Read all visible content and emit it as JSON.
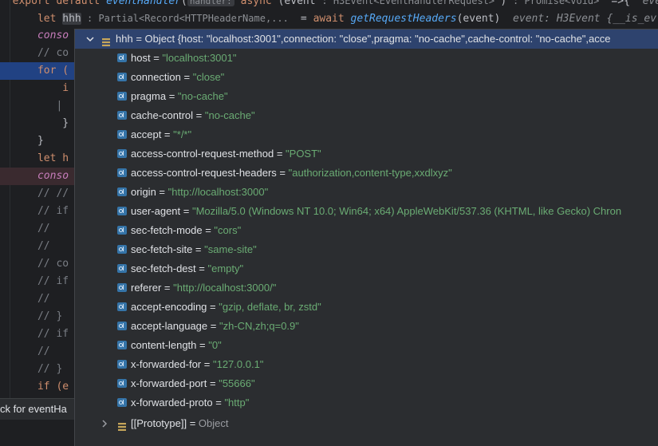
{
  "editor": {
    "lines": [
      {
        "parts": [
          {
            "t": "export default ",
            "c": "kw"
          },
          {
            "t": "eventHandler",
            "c": "fn-italic"
          },
          {
            "t": "(",
            "c": "var"
          },
          {
            "t": "handler:",
            "c": "hint-box"
          },
          {
            "t": " async ",
            "c": "kw"
          },
          {
            "t": "(event ",
            "c": "var"
          },
          {
            "t": ": H3Event<EventHandlerRequest> ",
            "c": "hint"
          },
          {
            "t": ") ",
            "c": "var"
          },
          {
            "t": ": Promise<void> ",
            "c": "hint"
          },
          {
            "t": " =>{  ",
            "c": "var"
          },
          {
            "t": "event",
            "c": "inline-val"
          }
        ]
      },
      {
        "parts": [
          {
            "t": "    let ",
            "c": "kw"
          },
          {
            "t": "hhh",
            "c": "ident-box"
          },
          {
            "t": " : Partial<Record<HTTPHeaderName,... ",
            "c": "hint"
          },
          {
            "t": " = ",
            "c": "var"
          },
          {
            "t": "await ",
            "c": "kw"
          },
          {
            "t": "getRequestHeaders",
            "c": "fn-italic"
          },
          {
            "t": "(event)  ",
            "c": "var"
          },
          {
            "t": "event: H3Event {__is_ev",
            "c": "inline-val"
          }
        ]
      },
      {
        "parts": [
          {
            "t": "    conso",
            "c": "purple"
          }
        ]
      },
      {
        "parts": [
          {
            "t": "    // co",
            "c": "cmt"
          }
        ]
      },
      {
        "parts": [
          {
            "t": "    for (",
            "c": "kw"
          }
        ],
        "style": "hl-line"
      },
      {
        "parts": [
          {
            "t": "        i",
            "c": "kw"
          }
        ]
      },
      {
        "parts": [
          {
            "t": "       |",
            "c": "cmt"
          }
        ]
      },
      {
        "parts": [
          {
            "t": "        }",
            "c": "var"
          }
        ]
      },
      {
        "parts": [
          {
            "t": "    }",
            "c": "var"
          }
        ]
      },
      {
        "parts": [
          {
            "t": "    let h",
            "c": "kw"
          }
        ]
      },
      {
        "parts": [
          {
            "t": "    conso",
            "c": "purple"
          }
        ],
        "style": "err-line"
      },
      {
        "parts": [
          {
            "t": "    // //",
            "c": "cmt"
          }
        ]
      },
      {
        "parts": [
          {
            "t": "    // if",
            "c": "cmt"
          }
        ]
      },
      {
        "parts": [
          {
            "t": "    //",
            "c": "cmt"
          }
        ]
      },
      {
        "parts": [
          {
            "t": "    //",
            "c": "cmt"
          }
        ]
      },
      {
        "parts": [
          {
            "t": "    // co",
            "c": "cmt"
          }
        ]
      },
      {
        "parts": [
          {
            "t": "    // if",
            "c": "cmt"
          }
        ]
      },
      {
        "parts": [
          {
            "t": "    //",
            "c": "cmt"
          }
        ]
      },
      {
        "parts": [
          {
            "t": "    // }",
            "c": "cmt"
          }
        ]
      },
      {
        "parts": [
          {
            "t": "    // if",
            "c": "cmt"
          }
        ]
      },
      {
        "parts": [
          {
            "t": "    //",
            "c": "cmt"
          }
        ]
      },
      {
        "parts": [
          {
            "t": "    // }",
            "c": "cmt"
          }
        ]
      },
      {
        "parts": [
          {
            "t": "    if (e",
            "c": "kw"
          }
        ]
      }
    ],
    "status_tip": "ck for eventHa"
  },
  "popup": {
    "root": {
      "name": "hhh",
      "summary": "Object {host: \"localhost:3001\",connection: \"close\",pragma: \"no-cache\",cache-control: \"no-cache\",acce"
    },
    "fields": [
      {
        "name": "host",
        "value": "\"localhost:3001\""
      },
      {
        "name": "connection",
        "value": "\"close\""
      },
      {
        "name": "pragma",
        "value": "\"no-cache\""
      },
      {
        "name": "cache-control",
        "value": "\"no-cache\""
      },
      {
        "name": "accept",
        "value": "\"*/*\""
      },
      {
        "name": "access-control-request-method",
        "value": "\"POST\""
      },
      {
        "name": "access-control-request-headers",
        "value": "\"authorization,content-type,xxdlxyz\""
      },
      {
        "name": "origin",
        "value": "\"http://localhost:3000\""
      },
      {
        "name": "user-agent",
        "value": "\"Mozilla/5.0 (Windows NT 10.0; Win64; x64) AppleWebKit/537.36 (KHTML, like Gecko) Chron"
      },
      {
        "name": "sec-fetch-mode",
        "value": "\"cors\""
      },
      {
        "name": "sec-fetch-site",
        "value": "\"same-site\""
      },
      {
        "name": "sec-fetch-dest",
        "value": "\"empty\""
      },
      {
        "name": "referer",
        "value": "\"http://localhost:3000/\""
      },
      {
        "name": "accept-encoding",
        "value": "\"gzip, deflate, br, zstd\""
      },
      {
        "name": "accept-language",
        "value": "\"zh-CN,zh;q=0.9\""
      },
      {
        "name": "content-length",
        "value": "\"0\""
      },
      {
        "name": "x-forwarded-for",
        "value": "\"127.0.0.1\""
      },
      {
        "name": "x-forwarded-port",
        "value": "\"55666\""
      },
      {
        "name": "x-forwarded-proto",
        "value": "\"http\""
      }
    ],
    "prototype": {
      "name": "[[Prototype]]",
      "value": "Object"
    }
  },
  "colors": {
    "string_value": "#6aab73",
    "selection": "#2e436e",
    "field_icon": "#3574a8",
    "object_icon": "#c6a65a"
  }
}
